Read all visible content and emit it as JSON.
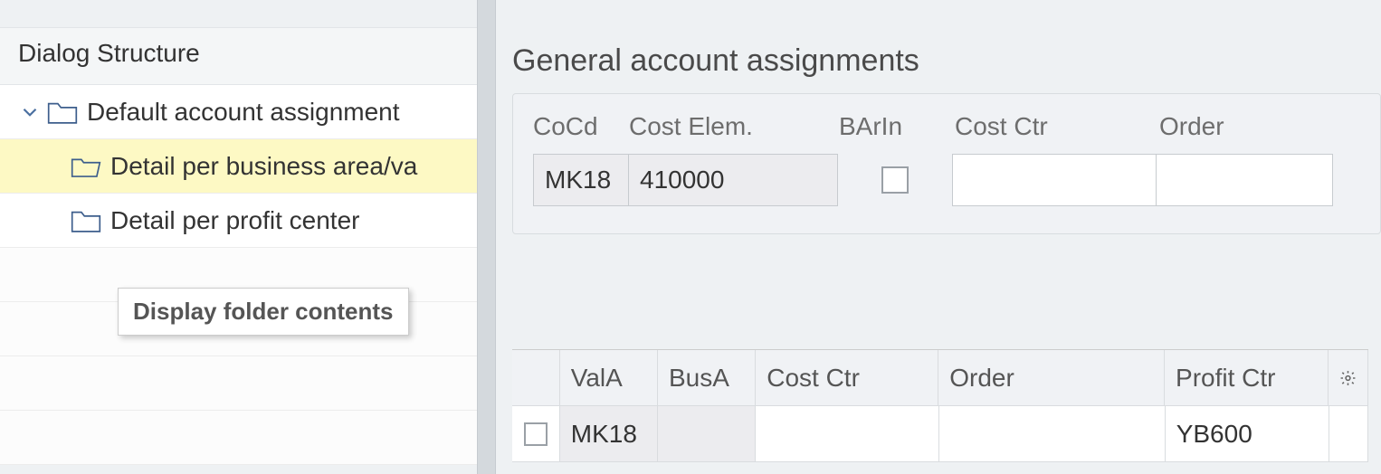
{
  "left": {
    "title": "Dialog Structure",
    "nodes": {
      "root": "Default account assignment",
      "child_biz": "Detail per business area/va",
      "child_pc": "Detail per profit center"
    },
    "tooltip": "Display folder contents"
  },
  "right": {
    "title": "General account assignments",
    "form_headers": {
      "cocd": "CoCd",
      "cost_elem": "Cost Elem.",
      "barin": "BArIn",
      "cost_ctr": "Cost Ctr",
      "order": "Order"
    },
    "form_row": {
      "cocd": "MK18",
      "cost_elem": "410000",
      "barin_checked": false,
      "cost_ctr": "",
      "order": ""
    },
    "table_headers": {
      "vala": "ValA",
      "busa": "BusA",
      "cost_ctr": "Cost Ctr",
      "order": "Order",
      "profit_ctr": "Profit Ctr"
    },
    "table_row": {
      "checked": false,
      "vala": "MK18",
      "busa": "",
      "cost_ctr": "",
      "order": "",
      "profit_ctr": "YB600"
    }
  }
}
